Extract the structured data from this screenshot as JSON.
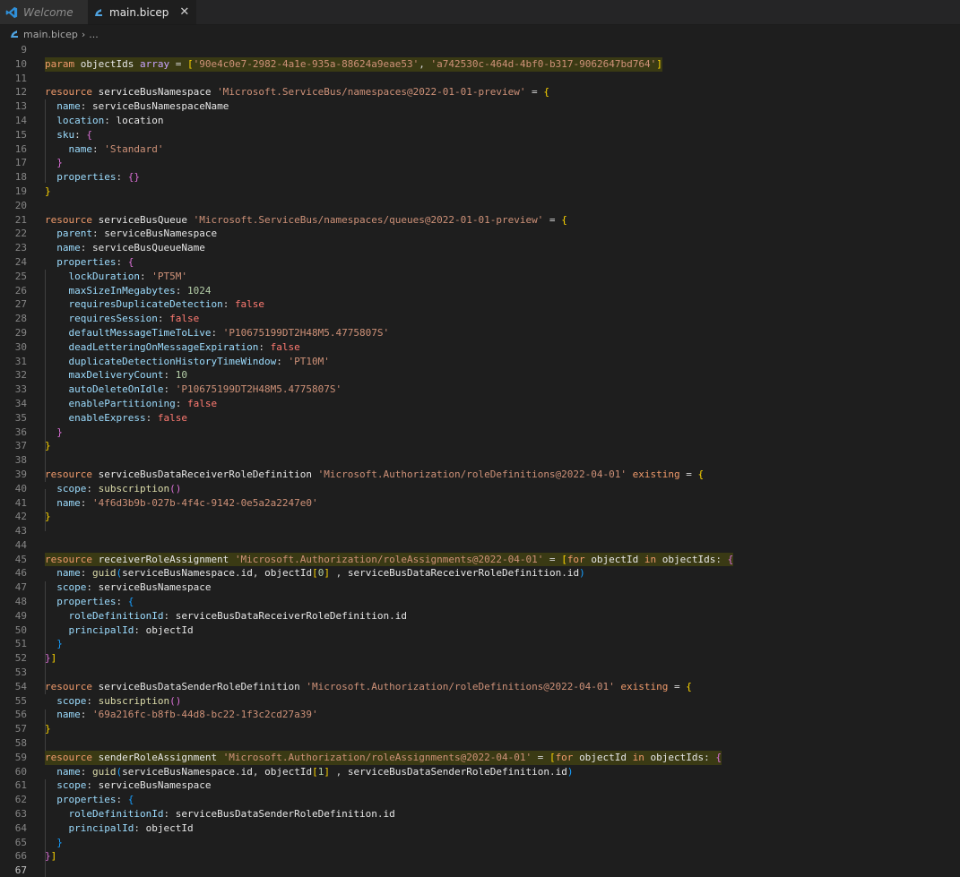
{
  "tabs": [
    {
      "label": "Welcome",
      "icon": "vscode-logo-icon",
      "active": false
    },
    {
      "label": "main.bicep",
      "icon": "bicep-file-icon",
      "active": true
    }
  ],
  "breadcrumb": {
    "file": "main.bicep",
    "more": "..."
  },
  "colors": {
    "highlight": "#3a3a14",
    "background": "#1e1e1e"
  },
  "lines": [
    {
      "n": "9",
      "t": []
    },
    {
      "n": "10",
      "h": true,
      "t": [
        [
          "kw2",
          "param "
        ],
        [
          "id",
          "objectIds "
        ],
        [
          "ty",
          "array"
        ],
        [
          "pu",
          " = "
        ],
        [
          "br1",
          "["
        ],
        [
          "st",
          "'90e4c0e7-2982-4a1e-935a-88624a9eae53'"
        ],
        [
          "pu",
          ", "
        ],
        [
          "st",
          "'a742530c-464d-4bf0-b317-9062647bd764'"
        ],
        [
          "br1",
          "]"
        ]
      ]
    },
    {
      "n": "11",
      "t": []
    },
    {
      "n": "12",
      "t": [
        [
          "kw2",
          "resource "
        ],
        [
          "id",
          "serviceBusNamespace "
        ],
        [
          "st",
          "'Microsoft.ServiceBus/namespaces@2022-01-01-preview'"
        ],
        [
          "pu",
          " = "
        ],
        [
          "br1",
          "{"
        ]
      ]
    },
    {
      "n": "13",
      "t": [
        [
          "pu",
          "  "
        ],
        [
          "prop",
          "name"
        ],
        [
          "pu",
          ": "
        ],
        [
          "id",
          "serviceBusNamespaceName"
        ]
      ]
    },
    {
      "n": "14",
      "t": [
        [
          "pu",
          "  "
        ],
        [
          "prop",
          "location"
        ],
        [
          "pu",
          ": "
        ],
        [
          "id",
          "location"
        ]
      ]
    },
    {
      "n": "15",
      "t": [
        [
          "pu",
          "  "
        ],
        [
          "prop",
          "sku"
        ],
        [
          "pu",
          ": "
        ],
        [
          "br2",
          "{"
        ]
      ]
    },
    {
      "n": "16",
      "t": [
        [
          "pu",
          "    "
        ],
        [
          "prop",
          "name"
        ],
        [
          "pu",
          ": "
        ],
        [
          "st",
          "'Standard'"
        ]
      ]
    },
    {
      "n": "17",
      "t": [
        [
          "pu",
          "  "
        ],
        [
          "br2",
          "}"
        ]
      ]
    },
    {
      "n": "18",
      "t": [
        [
          "pu",
          "  "
        ],
        [
          "prop",
          "properties"
        ],
        [
          "pu",
          ": "
        ],
        [
          "br2",
          "{}"
        ]
      ]
    },
    {
      "n": "19",
      "t": [
        [
          "br1",
          "}"
        ]
      ]
    },
    {
      "n": "20",
      "t": []
    },
    {
      "n": "21",
      "t": [
        [
          "kw2",
          "resource "
        ],
        [
          "id",
          "serviceBusQueue "
        ],
        [
          "st",
          "'Microsoft.ServiceBus/namespaces/queues@2022-01-01-preview'"
        ],
        [
          "pu",
          " = "
        ],
        [
          "br1",
          "{"
        ]
      ]
    },
    {
      "n": "22",
      "t": [
        [
          "pu",
          "  "
        ],
        [
          "prop",
          "parent"
        ],
        [
          "pu",
          ": "
        ],
        [
          "id",
          "serviceBusNamespace"
        ]
      ]
    },
    {
      "n": "23",
      "t": [
        [
          "pu",
          "  "
        ],
        [
          "prop",
          "name"
        ],
        [
          "pu",
          ": "
        ],
        [
          "id",
          "serviceBusQueueName"
        ]
      ]
    },
    {
      "n": "24",
      "t": [
        [
          "pu",
          "  "
        ],
        [
          "prop",
          "properties"
        ],
        [
          "pu",
          ": "
        ],
        [
          "br2",
          "{"
        ]
      ]
    },
    {
      "n": "25",
      "t": [
        [
          "pu",
          "    "
        ],
        [
          "prop",
          "lockDuration"
        ],
        [
          "pu",
          ": "
        ],
        [
          "st",
          "'PT5M'"
        ]
      ]
    },
    {
      "n": "26",
      "t": [
        [
          "pu",
          "    "
        ],
        [
          "prop",
          "maxSizeInMegabytes"
        ],
        [
          "pu",
          ": "
        ],
        [
          "nu",
          "1024"
        ]
      ]
    },
    {
      "n": "27",
      "t": [
        [
          "pu",
          "    "
        ],
        [
          "prop",
          "requiresDuplicateDetection"
        ],
        [
          "pu",
          ": "
        ],
        [
          "bo",
          "false"
        ]
      ]
    },
    {
      "n": "28",
      "t": [
        [
          "pu",
          "    "
        ],
        [
          "prop",
          "requiresSession"
        ],
        [
          "pu",
          ": "
        ],
        [
          "bo",
          "false"
        ]
      ]
    },
    {
      "n": "29",
      "t": [
        [
          "pu",
          "    "
        ],
        [
          "prop",
          "defaultMessageTimeToLive"
        ],
        [
          "pu",
          ": "
        ],
        [
          "st",
          "'P10675199DT2H48M5.4775807S'"
        ]
      ]
    },
    {
      "n": "30",
      "t": [
        [
          "pu",
          "    "
        ],
        [
          "prop",
          "deadLetteringOnMessageExpiration"
        ],
        [
          "pu",
          ": "
        ],
        [
          "bo",
          "false"
        ]
      ]
    },
    {
      "n": "31",
      "t": [
        [
          "pu",
          "    "
        ],
        [
          "prop",
          "duplicateDetectionHistoryTimeWindow"
        ],
        [
          "pu",
          ": "
        ],
        [
          "st",
          "'PT10M'"
        ]
      ]
    },
    {
      "n": "32",
      "t": [
        [
          "pu",
          "    "
        ],
        [
          "prop",
          "maxDeliveryCount"
        ],
        [
          "pu",
          ": "
        ],
        [
          "nu",
          "10"
        ]
      ]
    },
    {
      "n": "33",
      "t": [
        [
          "pu",
          "    "
        ],
        [
          "prop",
          "autoDeleteOnIdle"
        ],
        [
          "pu",
          ": "
        ],
        [
          "st",
          "'P10675199DT2H48M5.4775807S'"
        ]
      ]
    },
    {
      "n": "34",
      "t": [
        [
          "pu",
          "    "
        ],
        [
          "prop",
          "enablePartitioning"
        ],
        [
          "pu",
          ": "
        ],
        [
          "bo",
          "false"
        ]
      ]
    },
    {
      "n": "35",
      "t": [
        [
          "pu",
          "    "
        ],
        [
          "prop",
          "enableExpress"
        ],
        [
          "pu",
          ": "
        ],
        [
          "bo",
          "false"
        ]
      ]
    },
    {
      "n": "36",
      "t": [
        [
          "pu",
          "  "
        ],
        [
          "br2",
          "}"
        ]
      ]
    },
    {
      "n": "37",
      "t": [
        [
          "br1",
          "}"
        ]
      ]
    },
    {
      "n": "38",
      "t": []
    },
    {
      "n": "39",
      "t": [
        [
          "kw2",
          "resource "
        ],
        [
          "id",
          "serviceBusDataReceiverRoleDefinition "
        ],
        [
          "st",
          "'Microsoft.Authorization/roleDefinitions@2022-04-01'"
        ],
        [
          "pu",
          " "
        ],
        [
          "kw2",
          "existing"
        ],
        [
          "pu",
          " = "
        ],
        [
          "br1",
          "{"
        ]
      ]
    },
    {
      "n": "40",
      "t": [
        [
          "pu",
          "  "
        ],
        [
          "prop",
          "scope"
        ],
        [
          "pu",
          ": "
        ],
        [
          "fn",
          "subscription"
        ],
        [
          "br2",
          "()"
        ]
      ]
    },
    {
      "n": "41",
      "t": [
        [
          "pu",
          "  "
        ],
        [
          "prop",
          "name"
        ],
        [
          "pu",
          ": "
        ],
        [
          "st",
          "'4f6d3b9b-027b-4f4c-9142-0e5a2a2247e0'"
        ]
      ]
    },
    {
      "n": "42",
      "t": [
        [
          "br1",
          "}"
        ]
      ]
    },
    {
      "n": "43",
      "t": []
    },
    {
      "n": "44",
      "t": []
    },
    {
      "n": "45",
      "h": true,
      "t": [
        [
          "kw2",
          "resource "
        ],
        [
          "id",
          "receiverRoleAssignment "
        ],
        [
          "st",
          "'Microsoft.Authorization/roleAssignments@2022-04-01'"
        ],
        [
          "pu",
          " = "
        ],
        [
          "br1",
          "["
        ],
        [
          "kw2",
          "for "
        ],
        [
          "id",
          "objectId "
        ],
        [
          "kw2",
          "in "
        ],
        [
          "id",
          "objectIds"
        ],
        [
          "pu",
          ": "
        ],
        [
          "br2",
          "{"
        ]
      ]
    },
    {
      "n": "46",
      "t": [
        [
          "pu",
          "  "
        ],
        [
          "prop",
          "name"
        ],
        [
          "pu",
          ": "
        ],
        [
          "fn",
          "guid"
        ],
        [
          "br3",
          "("
        ],
        [
          "id",
          "serviceBusNamespace"
        ],
        [
          "pu",
          "."
        ],
        [
          "id",
          "id"
        ],
        [
          "pu",
          ", "
        ],
        [
          "id",
          "objectId"
        ],
        [
          "br1",
          "["
        ],
        [
          "nu",
          "0"
        ],
        [
          "br1",
          "]"
        ],
        [
          "pu",
          " , "
        ],
        [
          "id",
          "serviceBusDataReceiverRoleDefinition"
        ],
        [
          "pu",
          "."
        ],
        [
          "id",
          "id"
        ],
        [
          "br3",
          ")"
        ]
      ]
    },
    {
      "n": "47",
      "t": [
        [
          "pu",
          "  "
        ],
        [
          "prop",
          "scope"
        ],
        [
          "pu",
          ": "
        ],
        [
          "id",
          "serviceBusNamespace"
        ]
      ]
    },
    {
      "n": "48",
      "t": [
        [
          "pu",
          "  "
        ],
        [
          "prop",
          "properties"
        ],
        [
          "pu",
          ": "
        ],
        [
          "br3",
          "{"
        ]
      ]
    },
    {
      "n": "49",
      "t": [
        [
          "pu",
          "    "
        ],
        [
          "prop",
          "roleDefinitionId"
        ],
        [
          "pu",
          ": "
        ],
        [
          "id",
          "serviceBusDataReceiverRoleDefinition"
        ],
        [
          "pu",
          "."
        ],
        [
          "id",
          "id"
        ]
      ]
    },
    {
      "n": "50",
      "t": [
        [
          "pu",
          "    "
        ],
        [
          "prop",
          "principalId"
        ],
        [
          "pu",
          ": "
        ],
        [
          "id",
          "objectId"
        ]
      ]
    },
    {
      "n": "51",
      "t": [
        [
          "pu",
          "  "
        ],
        [
          "br3",
          "}"
        ]
      ]
    },
    {
      "n": "52",
      "t": [
        [
          "br2",
          "}"
        ],
        [
          "br1",
          "]"
        ]
      ]
    },
    {
      "n": "53",
      "t": []
    },
    {
      "n": "54",
      "t": [
        [
          "kw2",
          "resource "
        ],
        [
          "id",
          "serviceBusDataSenderRoleDefinition "
        ],
        [
          "st",
          "'Microsoft.Authorization/roleDefinitions@2022-04-01'"
        ],
        [
          "pu",
          " "
        ],
        [
          "kw2",
          "existing"
        ],
        [
          "pu",
          " = "
        ],
        [
          "br1",
          "{"
        ]
      ]
    },
    {
      "n": "55",
      "t": [
        [
          "pu",
          "  "
        ],
        [
          "prop",
          "scope"
        ],
        [
          "pu",
          ": "
        ],
        [
          "fn",
          "subscription"
        ],
        [
          "br2",
          "()"
        ]
      ]
    },
    {
      "n": "56",
      "t": [
        [
          "pu",
          "  "
        ],
        [
          "prop",
          "name"
        ],
        [
          "pu",
          ": "
        ],
        [
          "st",
          "'69a216fc-b8fb-44d8-bc22-1f3c2cd27a39'"
        ]
      ]
    },
    {
      "n": "57",
      "t": [
        [
          "br1",
          "}"
        ]
      ]
    },
    {
      "n": "58",
      "t": []
    },
    {
      "n": "59",
      "h": true,
      "t": [
        [
          "kw2",
          "resource "
        ],
        [
          "id",
          "senderRoleAssignment "
        ],
        [
          "st",
          "'Microsoft.Authorization/roleAssignments@2022-04-01'"
        ],
        [
          "pu",
          " = "
        ],
        [
          "br1",
          "["
        ],
        [
          "kw2",
          "for "
        ],
        [
          "id",
          "objectId "
        ],
        [
          "kw2",
          "in "
        ],
        [
          "id",
          "objectIds"
        ],
        [
          "pu",
          ": "
        ],
        [
          "br2",
          "{"
        ]
      ]
    },
    {
      "n": "60",
      "t": [
        [
          "pu",
          "  "
        ],
        [
          "prop",
          "name"
        ],
        [
          "pu",
          ": "
        ],
        [
          "fn",
          "guid"
        ],
        [
          "br3",
          "("
        ],
        [
          "id",
          "serviceBusNamespace"
        ],
        [
          "pu",
          "."
        ],
        [
          "id",
          "id"
        ],
        [
          "pu",
          ", "
        ],
        [
          "id",
          "objectId"
        ],
        [
          "br1",
          "["
        ],
        [
          "nu",
          "1"
        ],
        [
          "br1",
          "]"
        ],
        [
          "pu",
          " , "
        ],
        [
          "id",
          "serviceBusDataSenderRoleDefinition"
        ],
        [
          "pu",
          "."
        ],
        [
          "id",
          "id"
        ],
        [
          "br3",
          ")"
        ]
      ]
    },
    {
      "n": "61",
      "t": [
        [
          "pu",
          "  "
        ],
        [
          "prop",
          "scope"
        ],
        [
          "pu",
          ": "
        ],
        [
          "id",
          "serviceBusNamespace"
        ]
      ]
    },
    {
      "n": "62",
      "t": [
        [
          "pu",
          "  "
        ],
        [
          "prop",
          "properties"
        ],
        [
          "pu",
          ": "
        ],
        [
          "br3",
          "{"
        ]
      ]
    },
    {
      "n": "63",
      "t": [
        [
          "pu",
          "    "
        ],
        [
          "prop",
          "roleDefinitionId"
        ],
        [
          "pu",
          ": "
        ],
        [
          "id",
          "serviceBusDataSenderRoleDefinition"
        ],
        [
          "pu",
          "."
        ],
        [
          "id",
          "id"
        ]
      ]
    },
    {
      "n": "64",
      "t": [
        [
          "pu",
          "    "
        ],
        [
          "prop",
          "principalId"
        ],
        [
          "pu",
          ": "
        ],
        [
          "id",
          "objectId"
        ]
      ]
    },
    {
      "n": "65",
      "t": [
        [
          "pu",
          "  "
        ],
        [
          "br3",
          "}"
        ]
      ]
    },
    {
      "n": "66",
      "t": [
        [
          "br2",
          "}"
        ],
        [
          "br1",
          "]"
        ]
      ]
    },
    {
      "n": "67",
      "cur": true,
      "t": []
    }
  ]
}
